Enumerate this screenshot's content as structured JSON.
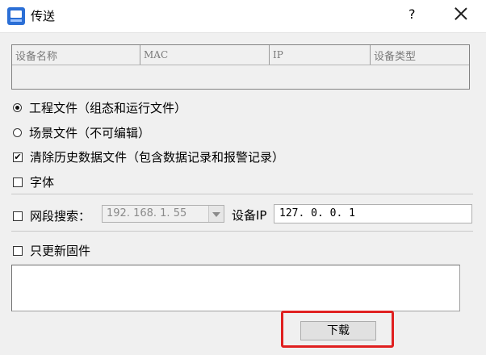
{
  "window": {
    "title": "传送",
    "help_label": "?"
  },
  "device_table": {
    "columns": [
      "设备名称",
      "MAC",
      "IP",
      "设备类型"
    ],
    "rows": []
  },
  "options": {
    "project_file_label": "工程文件（组态和运行文件）",
    "project_file_selected": true,
    "scene_file_label": "场景文件（不可编辑）",
    "scene_file_selected": false,
    "clear_history_label": "清除历史数据文件（包含数据记录和报警记录）",
    "clear_history_checked": true,
    "font_label": "字体",
    "font_checked": false,
    "segment_search_label": "网段搜索：",
    "segment_search_checked": false,
    "segment_value": "192. 168. 1. 55",
    "device_ip_label": "设备IP",
    "device_ip_value": "127. 0. 0. 1",
    "update_firmware_label": "只更新固件",
    "update_firmware_checked": false
  },
  "actions": {
    "download_label": "下载"
  },
  "colors": {
    "highlight": "#e02020",
    "app_icon": "#2b6fd6"
  }
}
